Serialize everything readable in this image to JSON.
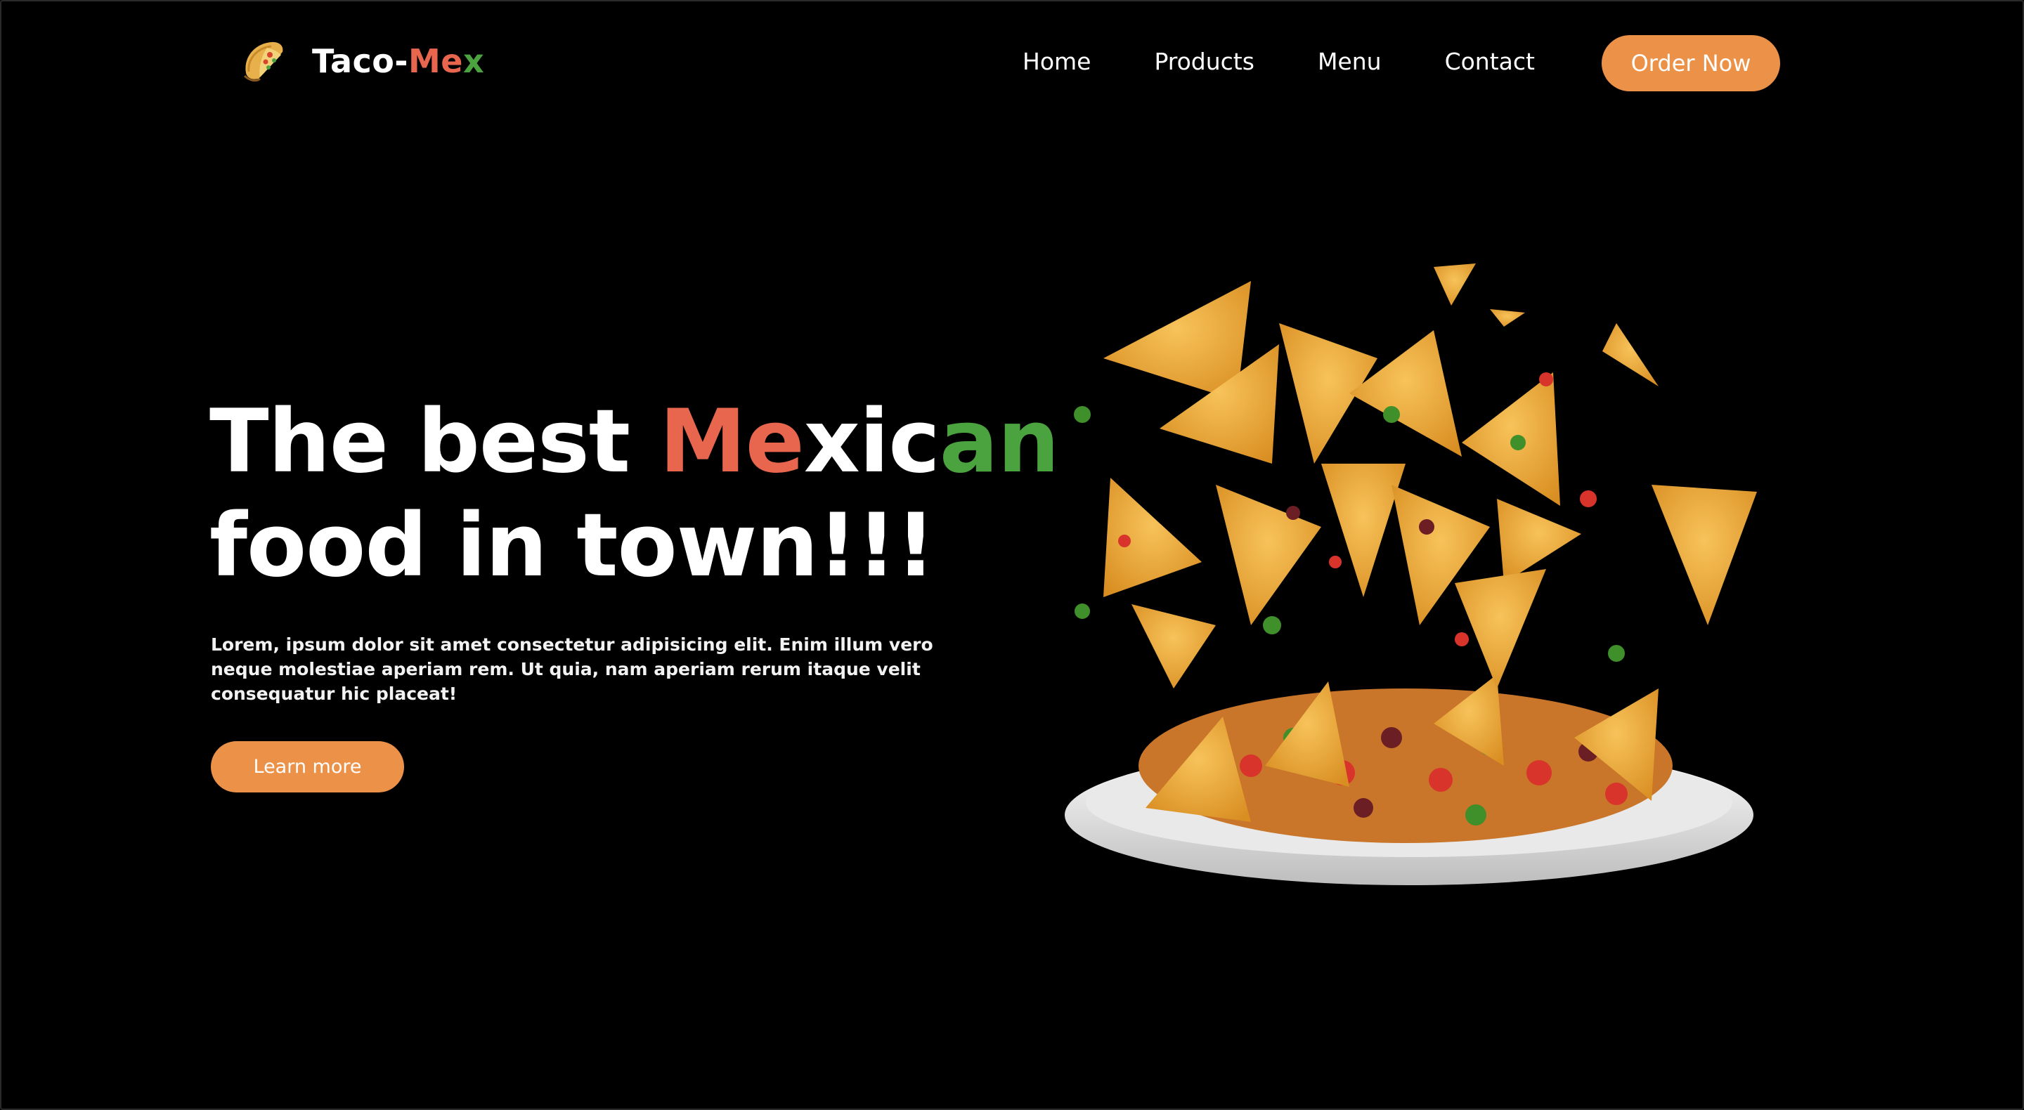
{
  "brand": {
    "name_part1": "Taco-",
    "name_part2": "Me",
    "name_part3": "x",
    "logo_icon": "taco-icon"
  },
  "nav": {
    "links": [
      {
        "label": "Home"
      },
      {
        "label": "Products"
      },
      {
        "label": "Menu"
      },
      {
        "label": "Contact"
      }
    ],
    "cta_label": "Order Now"
  },
  "hero": {
    "title_part1": "The best ",
    "title_part2": "Me",
    "title_part3": "xic",
    "title_part4": "an",
    "title_line2": "food in town!!!",
    "description": "Lorem, ipsum dolor sit amet consectetur adipisicing elit. Enim illum vero neque molestiae aperiam rem. Ut quia, nam aperiam rerum itaque velit consequatur hic placeat!",
    "button_label": "Learn more",
    "image_name": "nachos-plate-image"
  },
  "colors": {
    "background": "#000000",
    "accent_orange": "#ec9148",
    "accent_red": "#e8664e",
    "accent_green": "#4ba340",
    "text": "#ffffff"
  }
}
